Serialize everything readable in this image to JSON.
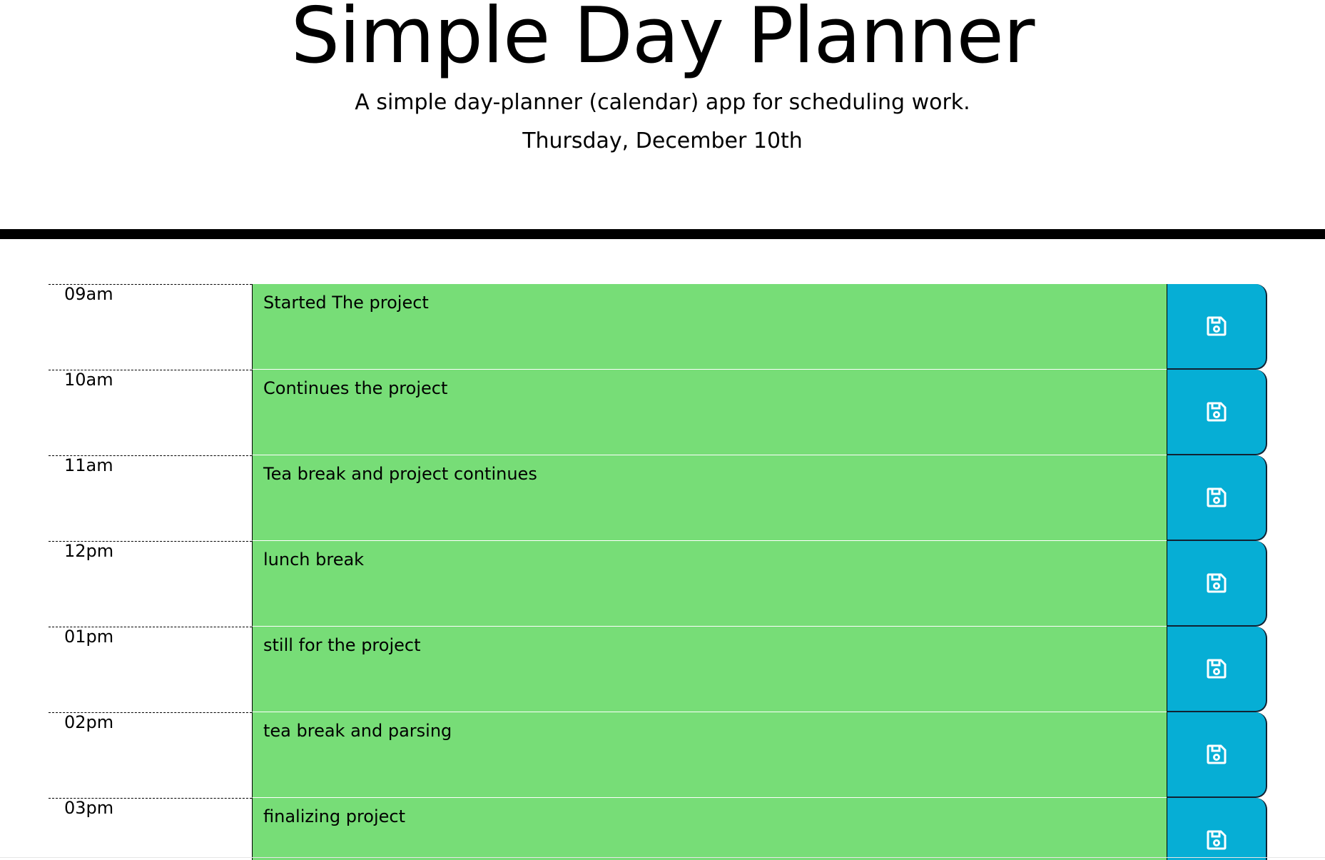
{
  "header": {
    "title": "Simple Day Planner",
    "lead": "A simple day-planner (calendar) app for scheduling work.",
    "current_day": "Thursday, December 10th"
  },
  "colors": {
    "present_or_future_block": "#77dd77",
    "save_button": "#06aed5",
    "divider": "#000000"
  },
  "time_blocks": [
    {
      "hour": "09am",
      "description": "Started The project",
      "save_icon": "floppy-disk-icon"
    },
    {
      "hour": "10am",
      "description": "Continues the project",
      "save_icon": "floppy-disk-icon"
    },
    {
      "hour": "11am",
      "description": "Tea break and project continues",
      "save_icon": "floppy-disk-icon"
    },
    {
      "hour": "12pm",
      "description": "lunch break",
      "save_icon": "floppy-disk-icon"
    },
    {
      "hour": "01pm",
      "description": "still for the project",
      "save_icon": "floppy-disk-icon"
    },
    {
      "hour": "02pm",
      "description": "tea break and parsing",
      "save_icon": "floppy-disk-icon"
    },
    {
      "hour": "03pm",
      "description": "finalizing project",
      "save_icon": "floppy-disk-icon"
    }
  ]
}
